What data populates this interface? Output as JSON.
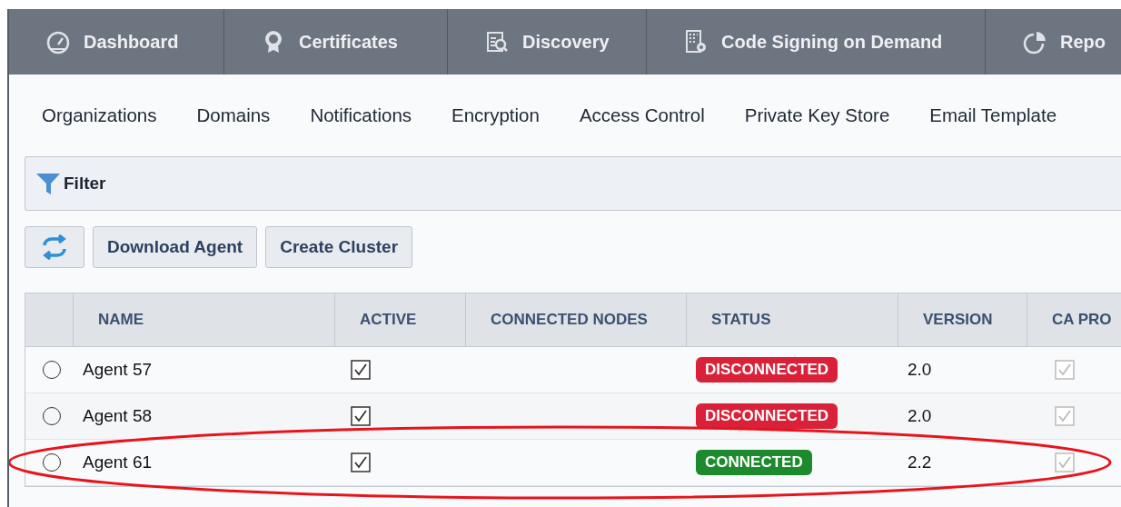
{
  "main_nav": [
    {
      "label": "Dashboard",
      "selected": false
    },
    {
      "label": "Certificates",
      "selected": false
    },
    {
      "label": "Discovery",
      "selected": false
    },
    {
      "label": "Code Signing on Demand",
      "selected": false
    },
    {
      "label": "Repo",
      "selected": false
    }
  ],
  "sub_nav": [
    "Organizations",
    "Domains",
    "Notifications",
    "Encryption",
    "Access Control",
    "Private Key Store",
    "Email Template"
  ],
  "filter": {
    "label": "Filter"
  },
  "toolbar": {
    "buttons": [
      {
        "kind": "refresh"
      },
      {
        "kind": "text",
        "label": "Download Agent"
      },
      {
        "kind": "text",
        "label": "Create Cluster"
      }
    ]
  },
  "table": {
    "columns": [
      "NAME",
      "ACTIVE",
      "CONNECTED NODES",
      "STATUS",
      "VERSION",
      "CA PRO"
    ],
    "rows": [
      {
        "selected": false,
        "name": "Agent 57",
        "active": true,
        "status": "DISCONNECTED",
        "color": "#d9223a",
        "version": "2.0",
        "column_6_checked": true,
        "highlighted": false
      },
      {
        "selected": false,
        "name": "Agent 58",
        "active": true,
        "status": "DISCONNECTED",
        "color": "#d9223a",
        "version": "2.0",
        "column_6_checked": true,
        "highlighted": false
      },
      {
        "selected": false,
        "name": "Agent 61",
        "active": true,
        "status": "CONNECTED",
        "color": "#1e8a2e",
        "version": "2.2",
        "column_6_checked": true,
        "highlighted": true
      }
    ]
  }
}
